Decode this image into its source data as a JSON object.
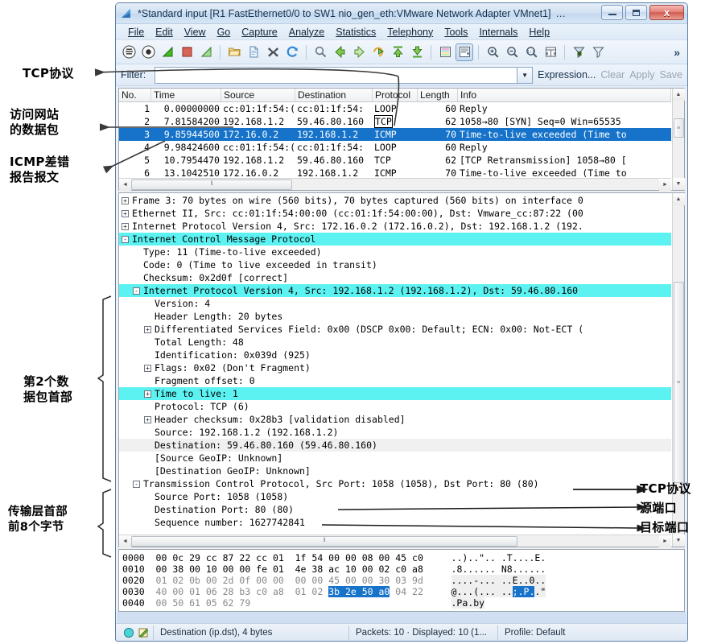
{
  "window": {
    "title": "*Standard input  [R1 FastEthernet0/0 to SW1 nio_gen_eth:VMware Network Adapter VMnet1]",
    "title_ellipsis": "…",
    "minimize_label": "Minimize",
    "maximize_label": "Maximize",
    "close_label": "x",
    "icon": "wireshark-shark-fin-icon"
  },
  "menubar": [
    {
      "label": "File"
    },
    {
      "label": "Edit"
    },
    {
      "label": "View"
    },
    {
      "label": "Go"
    },
    {
      "label": "Capture"
    },
    {
      "label": "Analyze"
    },
    {
      "label": "Statistics"
    },
    {
      "label": "Telephony"
    },
    {
      "label": "Tools"
    },
    {
      "label": "Internals"
    },
    {
      "label": "Help"
    }
  ],
  "toolbar": {
    "icons": [
      "interfaces-icon",
      "capture-options-icon",
      "start-capture-icon",
      "stop-capture-icon",
      "restart-capture-icon",
      "open-file-icon",
      "save-file-icon",
      "close-file-icon",
      "reload-icon",
      "find-packet-icon",
      "go-back-icon",
      "go-forward-icon",
      "go-to-packet-icon",
      "go-first-packet-icon",
      "go-last-packet-icon",
      "colorize-icon",
      "auto-scroll-icon",
      "zoom-in-icon",
      "zoom-out-icon",
      "zoom-reset-icon",
      "resize-columns-icon",
      "capture-filters-icon",
      "display-filters-icon"
    ],
    "overflow_label": "»"
  },
  "filterbar": {
    "label": "Filter:",
    "value": "",
    "placeholder": "",
    "dropdown_icon": "chevron-down-icon",
    "expression_label": "Expression...",
    "clear_label": "Clear",
    "apply_label": "Apply",
    "save_label": "Save"
  },
  "packet_list": {
    "columns": [
      "No.",
      "Time",
      "Source",
      "Destination",
      "Protocol",
      "Length",
      "Info"
    ],
    "rows": [
      {
        "no": "1",
        "time": "0.00000000",
        "source": "cc:01:1f:54:(",
        "destination": "cc:01:1f:54:",
        "protocol": "LOOP",
        "length": "60",
        "info": "Reply",
        "selected": false,
        "boxed_protocol": false
      },
      {
        "no": "2",
        "time": "7.81584200",
        "source": "192.168.1.2",
        "destination": "59.46.80.160",
        "protocol": "TCP",
        "length": "62",
        "info": "1058→80 [SYN] Seq=0 Win=65535",
        "selected": false,
        "boxed_protocol": true
      },
      {
        "no": "3",
        "time": "9.85944500",
        "source": "172.16.0.2",
        "destination": "192.168.1.2",
        "protocol": "ICMP",
        "length": "70",
        "info": "Time-to-live exceeded (Time to",
        "selected": true,
        "boxed_protocol": false
      },
      {
        "no": "4",
        "time": "9.98424600",
        "source": "cc:01:1f:54:(",
        "destination": "cc:01:1f:54:",
        "protocol": "LOOP",
        "length": "60",
        "info": "Reply",
        "selected": false,
        "boxed_protocol": false
      },
      {
        "no": "5",
        "time": "10.7954470",
        "source": "192.168.1.2",
        "destination": "59.46.80.160",
        "protocol": "TCP",
        "length": "62",
        "info": "[TCP Retransmission] 1058→80 [",
        "selected": false,
        "boxed_protocol": false
      },
      {
        "no": "6",
        "time": "13.1042510",
        "source": "172.16.0.2",
        "destination": "192.168.1.2",
        "protocol": "ICMP",
        "length": "70",
        "info": "Time-to-live exceeded (Time to",
        "selected": false,
        "boxed_protocol": false
      }
    ]
  },
  "packet_details": [
    {
      "indent": 0,
      "twisty": "+",
      "text": "Frame 3: 70 bytes on wire (560 bits), 70 bytes captured (560 bits) on interface 0",
      "style": ""
    },
    {
      "indent": 0,
      "twisty": "+",
      "text": "Ethernet II, Src: cc:01:1f:54:00:00 (cc:01:1f:54:00:00), Dst: Vmware_cc:87:22 (00",
      "style": ""
    },
    {
      "indent": 0,
      "twisty": "+",
      "text": "Internet Protocol Version 4, Src: 172.16.0.2 (172.16.0.2), Dst: 192.168.1.2 (192.",
      "style": ""
    },
    {
      "indent": 0,
      "twisty": "-",
      "text": "Internet Control Message Protocol",
      "style": "hl"
    },
    {
      "indent": 1,
      "twisty": "",
      "text": "Type: 11 (Time-to-live exceeded)",
      "style": ""
    },
    {
      "indent": 1,
      "twisty": "",
      "text": "Code: 0 (Time to live exceeded in transit)",
      "style": ""
    },
    {
      "indent": 1,
      "twisty": "",
      "text": "Checksum: 0x2d0f [correct]",
      "style": ""
    },
    {
      "indent": 1,
      "twisty": "-",
      "text": "Internet Protocol Version 4, Src: 192.168.1.2 (192.168.1.2), Dst: 59.46.80.160",
      "style": "hl"
    },
    {
      "indent": 2,
      "twisty": "",
      "text": "Version: 4",
      "style": ""
    },
    {
      "indent": 2,
      "twisty": "",
      "text": "Header Length: 20 bytes",
      "style": ""
    },
    {
      "indent": 2,
      "twisty": "+",
      "text": "Differentiated Services Field: 0x00 (DSCP 0x00: Default; ECN: 0x00: Not-ECT (",
      "style": ""
    },
    {
      "indent": 2,
      "twisty": "",
      "text": "Total Length: 48",
      "style": ""
    },
    {
      "indent": 2,
      "twisty": "",
      "text": "Identification: 0x039d (925)",
      "style": ""
    },
    {
      "indent": 2,
      "twisty": "+",
      "text": "Flags: 0x02 (Don't Fragment)",
      "style": ""
    },
    {
      "indent": 2,
      "twisty": "",
      "text": "Fragment offset: 0",
      "style": ""
    },
    {
      "indent": 2,
      "twisty": "+",
      "text": "Time to live: 1",
      "style": "hl"
    },
    {
      "indent": 2,
      "twisty": "",
      "text": "Protocol: TCP (6)",
      "style": ""
    },
    {
      "indent": 2,
      "twisty": "+",
      "text": "Header checksum: 0x28b3 [validation disabled]",
      "style": ""
    },
    {
      "indent": 2,
      "twisty": "",
      "text": "Source: 192.168.1.2 (192.168.1.2)",
      "style": ""
    },
    {
      "indent": 2,
      "twisty": "",
      "text": "Destination: 59.46.80.160 (59.46.80.160)",
      "style": "gray"
    },
    {
      "indent": 2,
      "twisty": "",
      "text": "[Source GeoIP: Unknown]",
      "style": ""
    },
    {
      "indent": 2,
      "twisty": "",
      "text": "[Destination GeoIP: Unknown]",
      "style": ""
    },
    {
      "indent": 1,
      "twisty": "-",
      "text": "Transmission Control Protocol, Src Port: 1058 (1058), Dst Port: 80 (80)",
      "style": ""
    },
    {
      "indent": 2,
      "twisty": "",
      "text": "Source Port: 1058 (1058)",
      "style": ""
    },
    {
      "indent": 2,
      "twisty": "",
      "text": "Destination Port: 80 (80)",
      "style": ""
    },
    {
      "indent": 2,
      "twisty": "",
      "text": "Sequence number: 1627742841",
      "style": ""
    }
  ],
  "hex_dump": [
    {
      "offset": "0000",
      "hex": "00 0c 29 cc 87 22 cc 01  1f 54 00 00 08 00 45 c0",
      "ascii": "..)..\".. .T....E."
    },
    {
      "offset": "0010",
      "hex": "00 38 00 10 00 00 fe 01  4e 38 ac 10 00 02 c0 a8",
      "ascii": ".8...... N8......"
    },
    {
      "offset": "0020",
      "hex": "01 02 0b 00 2d 0f 00 00  00 00 45 00 00 30 03 9d",
      "ascii": "....-... ..E..0.."
    },
    {
      "offset": "0030",
      "hex": "40 00 01 06 28 b3 c0 a8  01 02 3b 2e 50 a0 04 22",
      "ascii": "@...(... ..;.P..\""
    },
    {
      "offset": "0040",
      "hex": "00 50 61 05 62 79",
      "ascii": ".Pa.by"
    }
  ],
  "hex_selection": {
    "row_offset": "0030",
    "hex_selected": "3b 2e 50 a0",
    "ascii_selected": ";.P."
  },
  "statusbar": {
    "expert_icon": "expert-info-circle-icon",
    "annotation_icon": "capture-comment-icon",
    "field": "Destination (ip.dst), 4 bytes",
    "packets": "Packets: 10 · Displayed: 10 (1...",
    "profile": "Profile: Default"
  },
  "annotations": {
    "left": [
      {
        "text": "TCP协议",
        "id": "anno-tcp-protocol"
      },
      {
        "text": "访问网站\n的数据包",
        "id": "anno-website-packet"
      },
      {
        "text": "ICMP差错\n报告报文",
        "id": "anno-icmp-error-report"
      },
      {
        "text": "第2个数\n据包首部",
        "id": "anno-second-packet-header"
      },
      {
        "text": "传输层首部\n前8个字节",
        "id": "anno-transport-header-8bytes"
      }
    ],
    "right": [
      {
        "text": "TCP协议",
        "id": "anno-tcp-protocol-right"
      },
      {
        "text": "源端口",
        "id": "anno-source-port"
      },
      {
        "text": "目标端口",
        "id": "anno-dest-port"
      }
    ]
  }
}
